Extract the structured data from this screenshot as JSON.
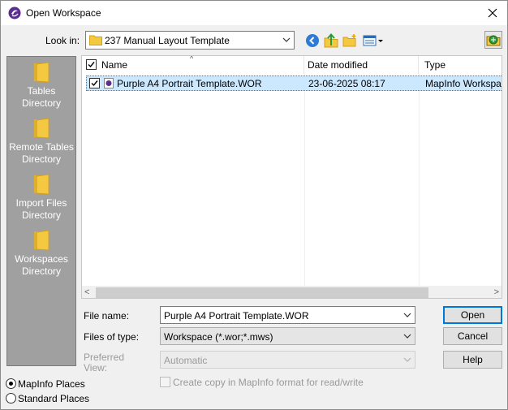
{
  "window": {
    "title": "Open Workspace"
  },
  "lookin": {
    "label": "Look in:",
    "value": "237 Manual Layout Template"
  },
  "places": [
    {
      "label_line1": "Tables",
      "label_line2": "Directory"
    },
    {
      "label_line1": "Remote Tables",
      "label_line2": "Directory"
    },
    {
      "label_line1": "Import Files",
      "label_line2": "Directory"
    },
    {
      "label_line1": "Workspaces",
      "label_line2": "Directory"
    }
  ],
  "filelist": {
    "columns": {
      "name": "Name",
      "date": "Date modified",
      "type": "Type"
    },
    "rows": [
      {
        "name": "Purple A4 Portrait Template.WOR",
        "date": "23-06-2025 08:17",
        "type": "MapInfo Workspace"
      }
    ]
  },
  "form": {
    "filename_label": "File name:",
    "filename_value": "Purple A4 Portrait Template.WOR",
    "filetype_label": "Files of type:",
    "filetype_value": "Workspace (*.wor;*.mws)",
    "preferred_label_line1": "Preferred",
    "preferred_label_line2": "View:",
    "preferred_value": "Automatic",
    "copy_label": "Create copy in MapInfo format for read/write"
  },
  "buttons": {
    "open": "Open",
    "cancel": "Cancel",
    "help": "Help"
  },
  "radios": {
    "mapinfo": "MapInfo Places",
    "standard": "Standard Places"
  },
  "colors": {
    "accent": "#0078d7",
    "selection": "#cce8ff",
    "places_bg": "#a0a0a0",
    "folder": "#f5c842"
  }
}
